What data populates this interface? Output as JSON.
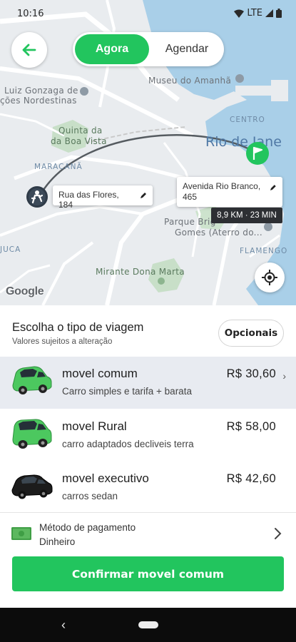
{
  "status": {
    "time": "10:16",
    "network": "LTE"
  },
  "header": {
    "tabs": [
      {
        "label": "Agora",
        "active": true
      },
      {
        "label": "Agendar",
        "active": false
      }
    ]
  },
  "map": {
    "labels": {
      "gonzaga": "Luiz Gonzaga de",
      "nordestinas": "ções Nordestinas",
      "museu": "Museu do Amanhã",
      "quinta": "Quinta da",
      "boa_vista": "da Boa Vista",
      "maracana": "MARACANÃ",
      "centro": "CENTRO",
      "rio": "Rio de Jane",
      "parque_1": "Parque Brig",
      "parque_2": "Gomes (Aterro do...",
      "flamengo": "FLAMENGO",
      "juca": "JUCA",
      "mirante": "Mirante Dona Marta",
      "google": "Google"
    },
    "origin_label": "Rua das Flores, 184",
    "destination_label": "Avenida Rio Branco, 465",
    "eta": "8,9 KM · 23 MIN"
  },
  "sheet": {
    "title": "Escolha o tipo de viagem",
    "subtitle": "Valores sujeitos a alteração",
    "options_button": "Opcionais",
    "rides": [
      {
        "name": "movel comum",
        "description": "Carro simples e tarifa + barata",
        "price": "R$ 30,60",
        "selected": true,
        "car_color": "#4cc85f"
      },
      {
        "name": "movel Rural",
        "description": "carro adaptados decliveis terra",
        "price": "R$ 58,00",
        "selected": false,
        "car_color": "#4cc85f"
      },
      {
        "name": "movel executivo",
        "description": "carros sedan",
        "price": "R$ 42,60",
        "selected": false,
        "car_color": "#1c1c1c"
      }
    ],
    "payment": {
      "label": "Método de pagamento",
      "value": "Dinheiro"
    },
    "confirm_button": "Confirmar movel comum"
  },
  "colors": {
    "accent": "#22c55e",
    "water": "#a9cfe8",
    "map_land": "#e9ecef",
    "selected_row": "#e8ebf1"
  },
  "icons": [
    "arrow-left-icon",
    "location-target-icon",
    "pencil-icon",
    "flag-icon",
    "person-pin-icon",
    "cash-icon",
    "chevron-right-icon"
  ]
}
